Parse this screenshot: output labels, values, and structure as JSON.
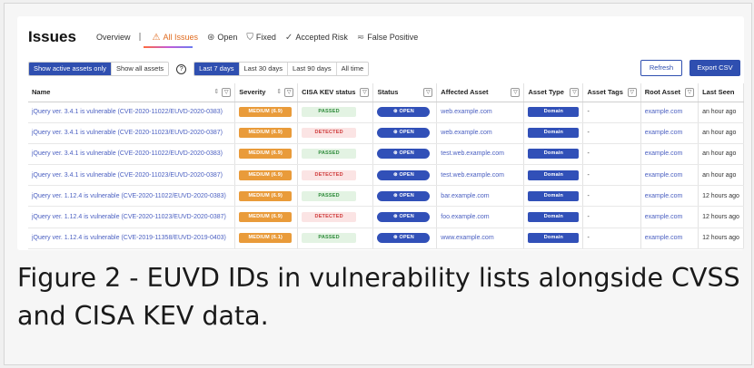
{
  "header": {
    "title": "Issues",
    "tabs": [
      {
        "label": "Overview",
        "icon": "",
        "active": false
      },
      {
        "label": "All Issues",
        "icon": "warning-icon",
        "active": true
      },
      {
        "label": "Open",
        "icon": "bug-icon",
        "active": false
      },
      {
        "label": "Fixed",
        "icon": "shield-check-icon",
        "active": false
      },
      {
        "label": "Accepted Risk",
        "icon": "check-circle-icon",
        "active": false
      },
      {
        "label": "False Positive",
        "icon": "filter-x-icon",
        "active": false
      }
    ],
    "separator": "|"
  },
  "controls": {
    "asset_toggle": [
      "Show active assets only",
      "Show all assets"
    ],
    "help": "?",
    "range": [
      "Last 7 days",
      "Last 30 days",
      "Last 90 days",
      "All time"
    ],
    "refresh": "Refresh",
    "export": "Export CSV"
  },
  "table": {
    "columns": [
      "Name",
      "Severity",
      "CISA KEV status",
      "Status",
      "Affected Asset",
      "Asset Type",
      "Asset Tags",
      "Root Asset",
      "Last Seen"
    ],
    "rows": [
      {
        "name": "jQuery ver. 3.4.1 is vulnerable (CVE-2020-11022/EUVD-2020-0383)",
        "severity": "MEDIUM (6.9)",
        "kev": "PASSED",
        "status": "OPEN",
        "asset": "web.example.com",
        "type": "Domain",
        "tags": "-",
        "root": "example.com",
        "seen": "an hour ago"
      },
      {
        "name": "jQuery ver. 3.4.1 is vulnerable (CVE-2020-11023/EUVD-2020-0387)",
        "severity": "MEDIUM (6.9)",
        "kev": "DETECTED",
        "status": "OPEN",
        "asset": "web.example.com",
        "type": "Domain",
        "tags": "-",
        "root": "example.com",
        "seen": "an hour ago"
      },
      {
        "name": "jQuery ver. 3.4.1 is vulnerable (CVE-2020-11022/EUVD-2020-0383)",
        "severity": "MEDIUM (6.9)",
        "kev": "PASSED",
        "status": "OPEN",
        "asset": "test.web.example.com",
        "type": "Domain",
        "tags": "-",
        "root": "example.com",
        "seen": "an hour ago"
      },
      {
        "name": "jQuery ver. 3.4.1 is vulnerable (CVE-2020-11023/EUVD-2020-0387)",
        "severity": "MEDIUM (6.9)",
        "kev": "DETECTED",
        "status": "OPEN",
        "asset": "test.web.example.com",
        "type": "Domain",
        "tags": "-",
        "root": "example.com",
        "seen": "an hour ago"
      },
      {
        "name": "jQuery ver. 1.12.4 is vulnerable (CVE-2020-11022/EUVD-2020-0383)",
        "severity": "MEDIUM (6.9)",
        "kev": "PASSED",
        "status": "OPEN",
        "asset": "bar.example.com",
        "type": "Domain",
        "tags": "-",
        "root": "example.com",
        "seen": "12 hours ago"
      },
      {
        "name": "jQuery ver. 1.12.4 is vulnerable (CVE-2020-11023/EUVD-2020-0387)",
        "severity": "MEDIUM (6.9)",
        "kev": "DETECTED",
        "status": "OPEN",
        "asset": "foo.example.com",
        "type": "Domain",
        "tags": "-",
        "root": "example.com",
        "seen": "12 hours ago"
      },
      {
        "name": "jQuery ver. 1.12.4 is vulnerable (CVE-2019-11358/EUVD-2019-0403)",
        "severity": "MEDIUM (6.1)",
        "kev": "PASSED",
        "status": "OPEN",
        "asset": "www.example.com",
        "type": "Domain",
        "tags": "-",
        "root": "example.com",
        "seen": "12 hours ago"
      }
    ]
  },
  "caption": "Figure 2 - EUVD IDs in vulnerability lists alongside CVSS and CISA KEV data.",
  "colors": {
    "accent": "#2f4fb0",
    "active_tab": "#e06b1f",
    "severity_medium": "#e99b3a",
    "kev_passed": "#2e8b3a",
    "kev_detected": "#cf3b3b"
  }
}
